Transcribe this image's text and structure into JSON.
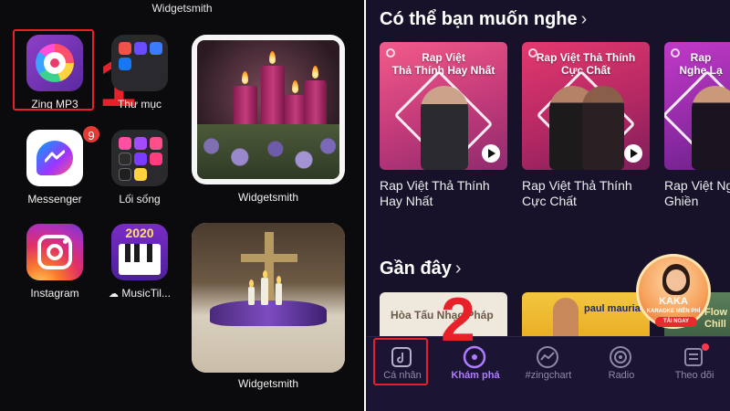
{
  "left": {
    "top_title": "Widgetsmith",
    "apps": {
      "zing": "Zing MP3",
      "folder": "Thư mục",
      "messenger": "Messenger",
      "messenger_badge": "9",
      "lifestyle": "Lối sống",
      "instagram": "Instagram",
      "musictiles": "MusicTil...",
      "musictiles_year": "2020"
    },
    "widget_top_label": "Widgetsmith",
    "widget_bottom_label": "Widgetsmith",
    "step_number": "1"
  },
  "right": {
    "section_suggest": "Có thể bạn muốn nghe",
    "section_recent": "Gần đây",
    "cards": [
      {
        "cover_text": "Rap Việt\nThả Thính Hay Nhất",
        "title": "Rap Việt Thả Thính Hay Nhất"
      },
      {
        "cover_text": "Rap Việt Thả Thính\nCực Chất",
        "title": "Rap Việt Thả Thính Cực Chất"
      },
      {
        "cover_text": "Rap\nNghe Lạ",
        "title": "Rap Việt Nghe Là Ghiền"
      }
    ],
    "recent": {
      "card1_text": "Hòa Tấu Nhạc Pháp",
      "card2_text": "paul mauriat",
      "card3_text": "Flow Chill"
    },
    "promo": {
      "title": "KAKA",
      "subtitle": "KARAOKE MIỄN PHÍ",
      "button": "TẢI NGAY"
    },
    "nav": [
      "Cá nhân",
      "Khám phá",
      "#zingchart",
      "Radio",
      "Theo dõi"
    ],
    "step_number": "2"
  },
  "colors": {
    "highlight_red": "#e8202a",
    "app_bg": "#17122a",
    "accent_purple": "#b07cff"
  }
}
